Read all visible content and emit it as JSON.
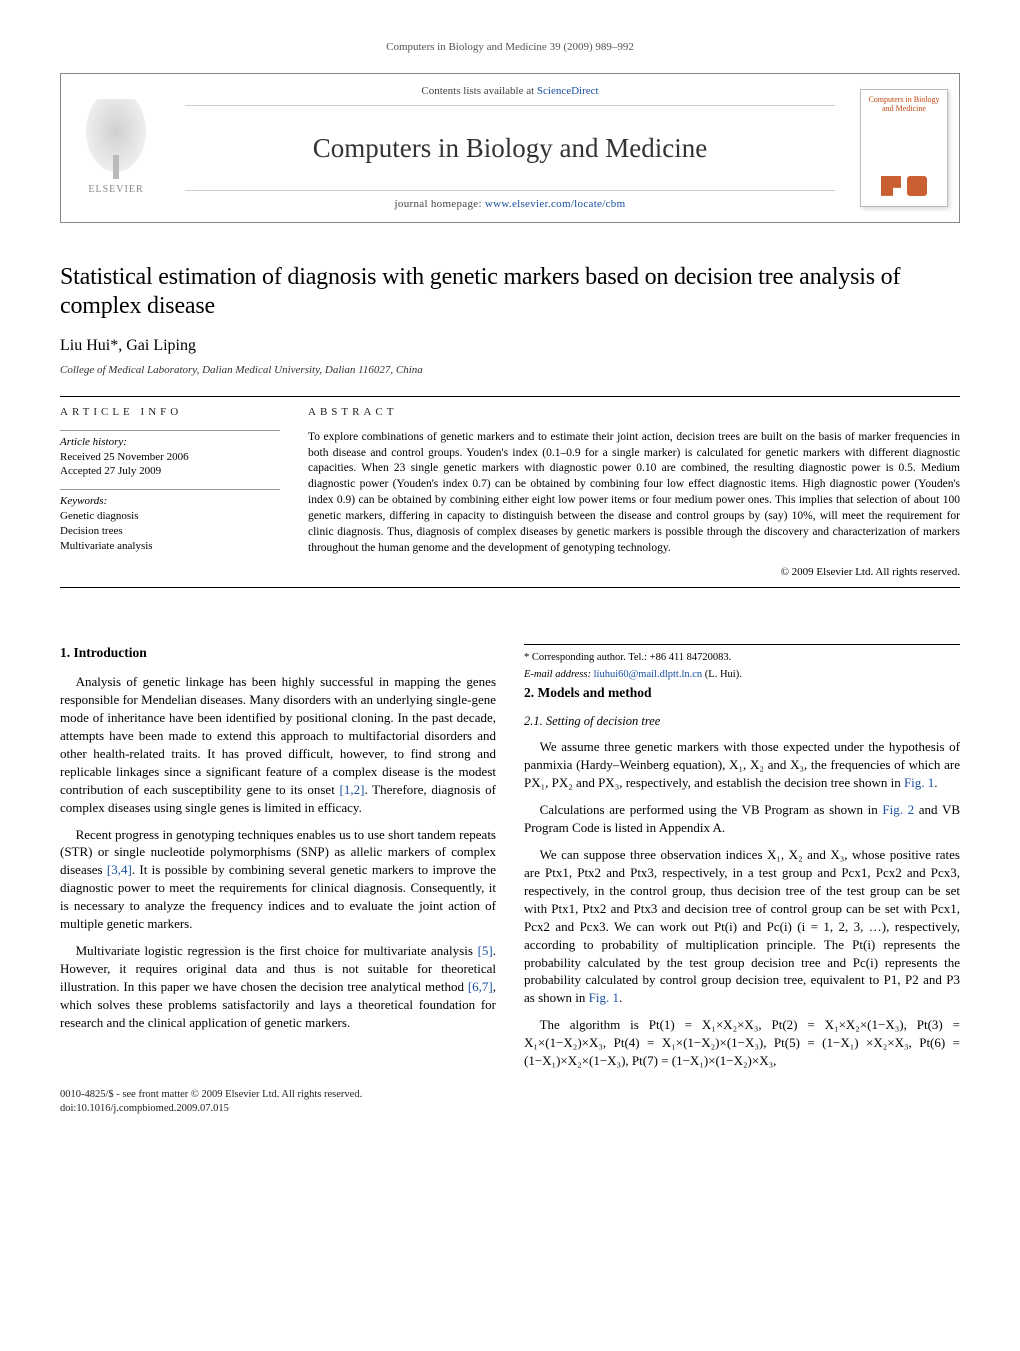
{
  "page_header": "Computers in Biology and Medicine 39 (2009) 989–992",
  "masthead": {
    "contents_line_prefix": "Contents lists available at ",
    "contents_line_link": "ScienceDirect",
    "journal_title": "Computers in Biology and Medicine",
    "homepage_prefix": "journal homepage: ",
    "homepage_link": "www.elsevier.com/locate/cbm",
    "publisher_name": "ELSEVIER",
    "cover_title": "Computers in Biology and Medicine"
  },
  "article": {
    "title": "Statistical estimation of diagnosis with genetic markers based on decision tree analysis of complex disease",
    "authors": "Liu Hui*, Gai Liping",
    "affiliation": "College of Medical Laboratory, Dalian Medical University, Dalian 116027, China"
  },
  "article_info": {
    "heading": "ARTICLE INFO",
    "history_label": "Article history:",
    "received": "Received 25 November 2006",
    "accepted": "Accepted 27 July 2009",
    "keywords_label": "Keywords:",
    "keywords": [
      "Genetic diagnosis",
      "Decision trees",
      "Multivariate analysis"
    ]
  },
  "abstract": {
    "heading": "ABSTRACT",
    "text": "To explore combinations of genetic markers and to estimate their joint action, decision trees are built on the basis of marker frequencies in both disease and control groups. Youden's index (0.1–0.9 for a single marker) is calculated for genetic markers with different diagnostic capacities. When 23 single genetic markers with diagnostic power 0.10 are combined, the resulting diagnostic power is 0.5. Medium diagnostic power (Youden's index 0.7) can be obtained by combining four low effect diagnostic items. High diagnostic power (Youden's index 0.9) can be obtained by combining either eight low power items or four medium power ones. This implies that selection of about 100 genetic markers, differing in capacity to distinguish between the disease and control groups by (say) 10%, will meet the requirement for clinic diagnosis. Thus, diagnosis of complex diseases by genetic markers is possible through the discovery and characterization of markers throughout the human genome and the development of genotyping technology.",
    "copyright": "© 2009 Elsevier Ltd. All rights reserved."
  },
  "sections": {
    "s1_title": "1. Introduction",
    "s1_p1": "Analysis of genetic linkage has been highly successful in mapping the genes responsible for Mendelian diseases. Many disorders with an underlying single-gene mode of inheritance have been identified by positional cloning. In the past decade, attempts have been made to extend this approach to multifactorial disorders and other health-related traits. It has proved difficult, however, to find strong and replicable linkages since a significant feature of a complex disease is the modest contribution of each susceptibility gene to its onset ",
    "s1_p1_ref": "[1,2]",
    "s1_p1_tail": ". Therefore, diagnosis of complex diseases using single genes is limited in efficacy.",
    "s1_p2_a": "Recent progress in genotyping techniques enables us to use short tandem repeats (STR) or single nucleotide polymorphisms (SNP) as allelic markers of complex diseases ",
    "s1_p2_ref": "[3,4]",
    "s1_p2_b": ". It is possible by combining several genetic markers to improve the diagnostic power to meet the requirements for clinical diagnosis. Consequently, it is necessary to analyze the frequency indices and to evaluate the joint action of multiple genetic markers.",
    "s1_p3_a": "Multivariate logistic regression is the first choice for multivariate analysis ",
    "s1_p3_ref1": "[5]",
    "s1_p3_b": ". However, it requires original data and thus is not suitable for theoretical illustration. In this paper we have chosen the decision tree analytical method ",
    "s1_p3_ref2": "[6,7]",
    "s1_p3_c": ", which solves these problems satisfactorily and lays a theoretical foundation for research and the clinical application of genetic markers.",
    "s2_title": "2. Models and method",
    "s21_title": "2.1. Setting of decision tree",
    "s21_p1_a": "We assume three genetic markers with those expected under the hypothesis of panmixia (Hardy–Weinberg equation), X₁, X₂ and X₃, the frequencies of which are PX₁, PX₂ and PX₃, respectively, and establish the decision tree shown in ",
    "s21_p1_fig": "Fig. 1",
    "s21_p1_b": ".",
    "s21_p2_a": "Calculations are performed using the VB Program as shown in ",
    "s21_p2_fig": "Fig. 2",
    "s21_p2_b": " and VB Program Code is listed in Appendix A.",
    "s21_p3_a": "We can suppose three observation indices X₁, X₂ and X₃, whose positive rates are Ptx1, Ptx2 and Ptx3, respectively, in a test group and Pcx1, Pcx2 and Pcx3, respectively, in the control group, thus decision tree of the test group can be set with Ptx1, Ptx2 and Ptx3 and decision tree of control group can be set with Pcx1, Pcx2 and Pcx3. We can work out Pt(i) and Pc(i) (i = 1, 2, 3, …), respectively, according to probability of multiplication principle. The Pt(i) represents the probability calculated by the test group decision tree and Pc(i) represents the probability calculated by control group decision tree, equivalent to P1, P2 and P3 as shown in ",
    "s21_p3_fig": "Fig. 1",
    "s21_p3_b": ".",
    "s21_p4": "The algorithm is Pt(1) = X₁×X₂×X₃, Pt(2) = X₁×X₂×(1−X₃), Pt(3) = X₁×(1−X₂)×X₃, Pt(4) = X₁×(1−X₂)×(1−X₃), Pt(5) = (1−X₁) ×X₂×X₃, Pt(6) = (1−X₁)×X₂×(1−X₃), Pt(7) = (1−X₁)×(1−X₂)×X₃,"
  },
  "correspondence": {
    "line1": "* Corresponding author. Tel.: +86 411 84720083.",
    "email_label": "E-mail address: ",
    "email": "liuhui60@mail.dlptt.ln.cn",
    "email_tail": " (L. Hui)."
  },
  "footer": {
    "issn_line": "0010-4825/$ - see front matter © 2009 Elsevier Ltd. All rights reserved.",
    "doi_line": "doi:10.1016/j.compbiomed.2009.07.015"
  }
}
